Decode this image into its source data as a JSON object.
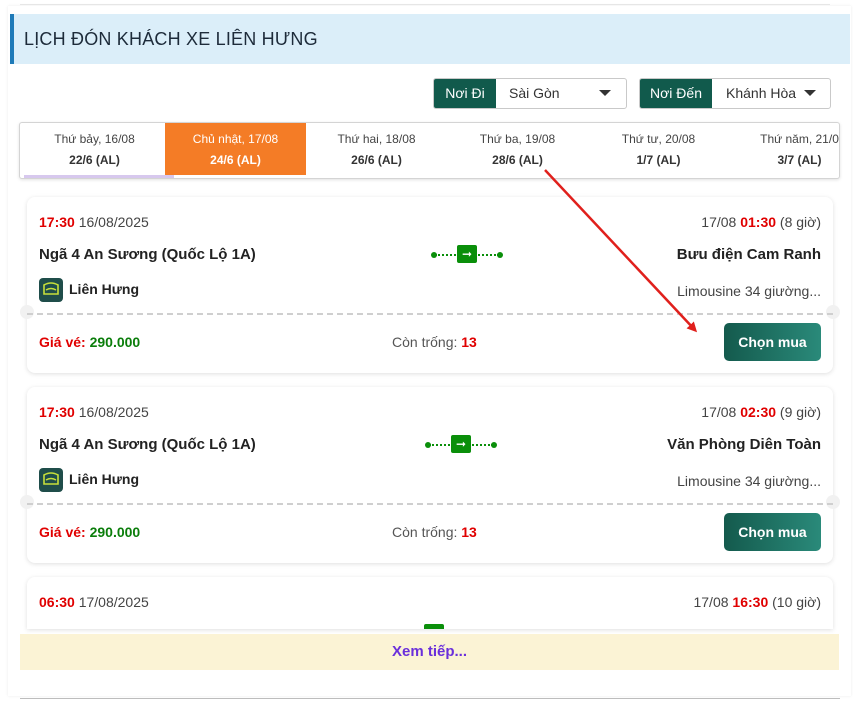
{
  "header": {
    "title": "LỊCH ĐÓN KHÁCH XE LIÊN HƯNG"
  },
  "filters": {
    "origin": {
      "tag": "Nơi Đi",
      "value": "Sài Gòn"
    },
    "destination": {
      "tag": "Nơi Đến",
      "value": "Khánh Hòa"
    }
  },
  "dates": [
    {
      "day": "Thứ bảy, 16/08",
      "lunar": "22/6 (AL)"
    },
    {
      "day": "Chủ nhật, 17/08",
      "lunar": "24/6 (AL)"
    },
    {
      "day": "Thứ hai, 18/08",
      "lunar": "26/6 (AL)"
    },
    {
      "day": "Thứ ba, 19/08",
      "lunar": "28/6 (AL)"
    },
    {
      "day": "Thứ tư, 20/08",
      "lunar": "1/7 (AL)"
    },
    {
      "day": "Thứ năm, 21/0",
      "lunar": "3/7 (AL)"
    }
  ],
  "trips": [
    {
      "dep_time": "17:30",
      "dep_date": "16/08/2025",
      "arr_date": "17/08",
      "arr_time": "01:30",
      "duration": "(8 giờ)",
      "from": "Ngã 4 An Sương (Quốc Lộ 1A)",
      "to": "Bưu điện Cam Ranh",
      "operator": "Liên Hưng",
      "vehicle": "Limousine 34 giường...",
      "price_label": "Giá vé:",
      "price": "290.000",
      "seats_label": "Còn trống:",
      "seats": "13",
      "buy_label": "Chọn mua"
    },
    {
      "dep_time": "17:30",
      "dep_date": "16/08/2025",
      "arr_date": "17/08",
      "arr_time": "02:30",
      "duration": "(9 giờ)",
      "from": "Ngã 4 An Sương (Quốc Lộ 1A)",
      "to": "Văn Phòng Diên Toàn",
      "operator": "Liên Hưng",
      "vehicle": "Limousine 34 giường...",
      "price_label": "Giá vé:",
      "price": "290.000",
      "seats_label": "Còn trống:",
      "seats": "13",
      "buy_label": "Chọn mua"
    },
    {
      "dep_time": "06:30",
      "dep_date": "17/08/2025",
      "arr_date": "17/08",
      "arr_time": "16:30",
      "duration": "(10 giờ)"
    }
  ],
  "load_more": "Xem tiếp...",
  "colors": {
    "accent_orange": "#f47c26",
    "brand_green": "#115a4c",
    "time_red": "#e00000",
    "price_green": "#0a7d0a",
    "load_more_purple": "#6a2fdb",
    "annotation_arrow": "#e0201c"
  },
  "icons": {
    "caret": "caret-down-icon",
    "route": "bus-route-icon",
    "operator_logo": "lien-hung-logo-icon"
  }
}
